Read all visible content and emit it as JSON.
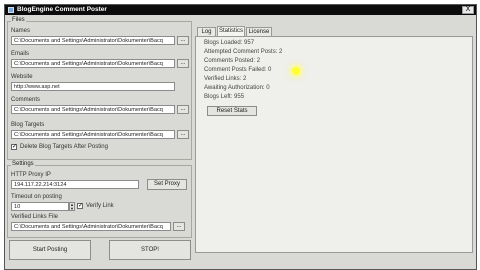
{
  "window": {
    "title": "BlogEngine Comment Poster",
    "close_label": "X"
  },
  "files": {
    "group_label": "Files",
    "names": {
      "label": "Names",
      "value": "C:\\Documents and Settings\\Administrator\\Dokumenter\\Bacq"
    },
    "emails": {
      "label": "Emails",
      "value": "C:\\Documents and Settings\\Administrator\\Dokumenter\\Bacq"
    },
    "website": {
      "label": "Website",
      "value": "http://www.asp.net"
    },
    "comments": {
      "label": "Comments",
      "value": "C:\\Documents and Settings\\Administrator\\Dokumenter\\Bacq"
    },
    "blog_targets": {
      "label": "Blog Targets",
      "value": "C:\\Documents and Settings\\Administrator\\Dokumenter\\Bacq"
    },
    "browse_label": "...",
    "delete_checkbox": {
      "label": "Delete Blog Targets After Posting",
      "checked": true,
      "mark": "✓"
    }
  },
  "settings": {
    "group_label": "Settings",
    "proxy": {
      "label": "HTTP Proxy IP",
      "value": "194.117.22.214:3124"
    },
    "set_proxy_label": "Set Proxy",
    "timeout": {
      "label": "Timeout on posting",
      "value": "10"
    },
    "verify_link": {
      "label": "Verify Link",
      "checked": true,
      "mark": "✓"
    },
    "verified_links": {
      "label": "Verified Links File",
      "value": "C:\\Documents and Settings\\Administrator\\Dokumenter\\Bacq"
    },
    "browse_label": "..."
  },
  "actions": {
    "start": "Start Posting",
    "stop": "STOP!"
  },
  "tabs": [
    {
      "label": "Log"
    },
    {
      "label": "Statistics"
    },
    {
      "label": "License"
    }
  ],
  "stats": {
    "blogs_loaded": "Blogs Loaded: 957",
    "attempted": "Attempted Comment Posts: 2",
    "posted": "Comments Posted: 2",
    "failed": "Comment Posts Failed: 0",
    "verified": "Verified Links: 2",
    "awaiting": "Awaiting Authorization: 0",
    "left": "Blogs Left: 955",
    "reset_label": "Reset Stats"
  }
}
